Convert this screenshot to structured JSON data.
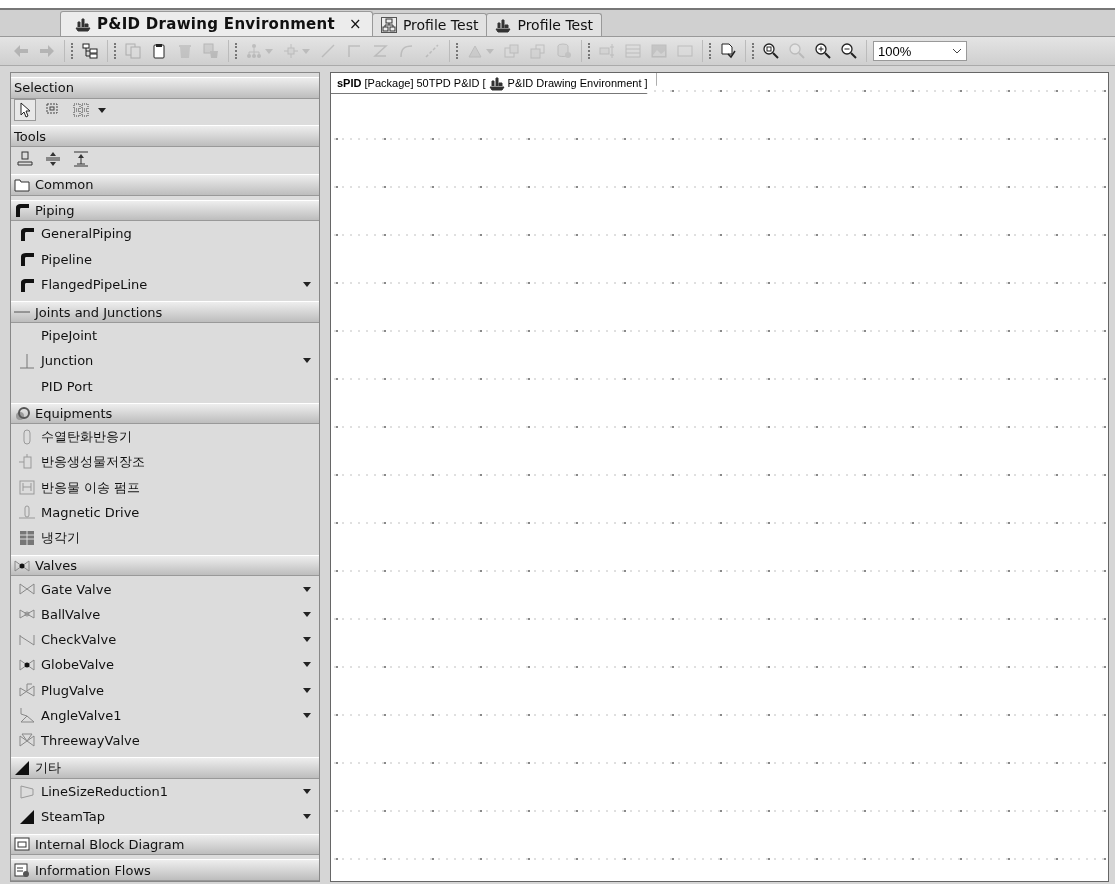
{
  "tabs": [
    {
      "label": "P&ID Drawing Environment",
      "kind": "ship",
      "selected": true,
      "close": "×"
    },
    {
      "label": "Profile Test",
      "kind": "diagram",
      "selected": false
    },
    {
      "label": "Profile Test",
      "kind": "ship",
      "selected": false
    }
  ],
  "toolbar": {
    "groups": [
      [
        {
          "kind": "back",
          "disabled": true
        },
        {
          "kind": "forward",
          "disabled": true
        }
      ],
      [
        {
          "kind": "tree",
          "disabled": false
        }
      ],
      [
        {
          "kind": "copy",
          "disabled": true
        },
        {
          "kind": "paste",
          "disabled": false
        },
        {
          "kind": "delete",
          "disabled": true
        },
        {
          "kind": "delete-model",
          "disabled": true
        }
      ],
      [
        {
          "kind": "hierarchy",
          "disabled": true,
          "has_menu": true
        },
        {
          "kind": "node",
          "disabled": true,
          "has_menu": true
        },
        {
          "kind": "line",
          "disabled": true
        },
        {
          "kind": "elbow",
          "disabled": true
        },
        {
          "kind": "zline",
          "disabled": true
        },
        {
          "kind": "curve",
          "disabled": true
        },
        {
          "kind": "dashed",
          "disabled": true
        }
      ],
      [
        {
          "kind": "shape",
          "disabled": true,
          "has_menu": true
        },
        {
          "kind": "front",
          "disabled": true
        },
        {
          "kind": "back-layer",
          "disabled": true
        },
        {
          "kind": "db",
          "disabled": true
        }
      ],
      [
        {
          "kind": "align",
          "disabled": true
        },
        {
          "kind": "table",
          "disabled": true
        },
        {
          "kind": "image",
          "disabled": true
        },
        {
          "kind": "rect",
          "disabled": true
        }
      ],
      [
        {
          "kind": "doc-check",
          "disabled": false
        }
      ],
      [
        {
          "kind": "zoom-fit",
          "disabled": false
        },
        {
          "kind": "zoom-actual",
          "disabled": true
        },
        {
          "kind": "zoom-in",
          "disabled": false
        },
        {
          "kind": "zoom-out",
          "disabled": false
        }
      ]
    ],
    "zoom": {
      "value": "100%"
    }
  },
  "palette": {
    "sections": [
      {
        "title": "Selection",
        "tools": [
          {
            "kind": "pointer",
            "selected": true
          },
          {
            "kind": "marquee",
            "selected": false
          },
          {
            "kind": "grid-select",
            "selected": false
          }
        ],
        "tools_menu": true
      },
      {
        "title": "Tools",
        "tools": [
          {
            "kind": "stamp",
            "selected": false
          },
          {
            "kind": "space",
            "selected": false
          },
          {
            "kind": "split",
            "selected": false
          }
        ],
        "tools_menu": false
      },
      {
        "title": "Common",
        "kind": "folder"
      },
      {
        "title": "Piping",
        "kind": "pipe",
        "items": [
          {
            "label": "GeneralPiping",
            "kind": "pipe",
            "has_menu": false
          },
          {
            "label": "Pipeline",
            "kind": "pipe",
            "has_menu": false
          },
          {
            "label": "FlangedPipeLine",
            "kind": "pipe",
            "has_menu": true
          }
        ]
      },
      {
        "title": "Joints and Junctions",
        "kind": "hline",
        "items": [
          {
            "label": "PipeJoint",
            "kind": "none",
            "has_menu": false
          },
          {
            "label": "Junction",
            "kind": "junction",
            "has_menu": true
          },
          {
            "label": "PID Port",
            "kind": "none",
            "has_menu": false
          }
        ]
      },
      {
        "title": "Equipments",
        "kind": "equip",
        "items": [
          {
            "label": "수열탄화반응기",
            "kind": "vessel",
            "has_menu": false
          },
          {
            "label": "반응생성물저장조",
            "kind": "tank",
            "has_menu": false
          },
          {
            "label": "반응물 이송 펌프",
            "kind": "pump",
            "has_menu": false
          },
          {
            "label": "Magnetic Drive",
            "kind": "drive",
            "has_menu": false
          },
          {
            "label": "냉각기",
            "kind": "cooler",
            "has_menu": false
          }
        ]
      },
      {
        "title": "Valves",
        "kind": "globe",
        "items": [
          {
            "label": "Gate Valve",
            "kind": "gate",
            "has_menu": true
          },
          {
            "label": "BallValve",
            "kind": "ball",
            "has_menu": true
          },
          {
            "label": "CheckValve",
            "kind": "check",
            "has_menu": true
          },
          {
            "label": "GlobeValve",
            "kind": "globe",
            "has_menu": true
          },
          {
            "label": "PlugValve",
            "kind": "plug",
            "has_menu": true
          },
          {
            "label": "AngleValve1",
            "kind": "angle",
            "has_menu": true
          },
          {
            "label": "ThreewayValve",
            "kind": "threeway",
            "has_menu": false
          }
        ]
      },
      {
        "title": "기타",
        "kind": "wedge",
        "items": [
          {
            "label": "LineSizeReduction1",
            "kind": "reducer",
            "has_menu": true
          },
          {
            "label": "SteamTap",
            "kind": "wedge",
            "has_menu": true
          }
        ]
      },
      {
        "title": "Internal Block Diagram",
        "kind": "ibd"
      },
      {
        "title": "Information Flows",
        "kind": "flows"
      }
    ]
  },
  "canvas": {
    "frame_title": "**sPID** [Package] 50TPD P&ID [",
    "frame_context": "P&ID Drawing Environment ]"
  }
}
